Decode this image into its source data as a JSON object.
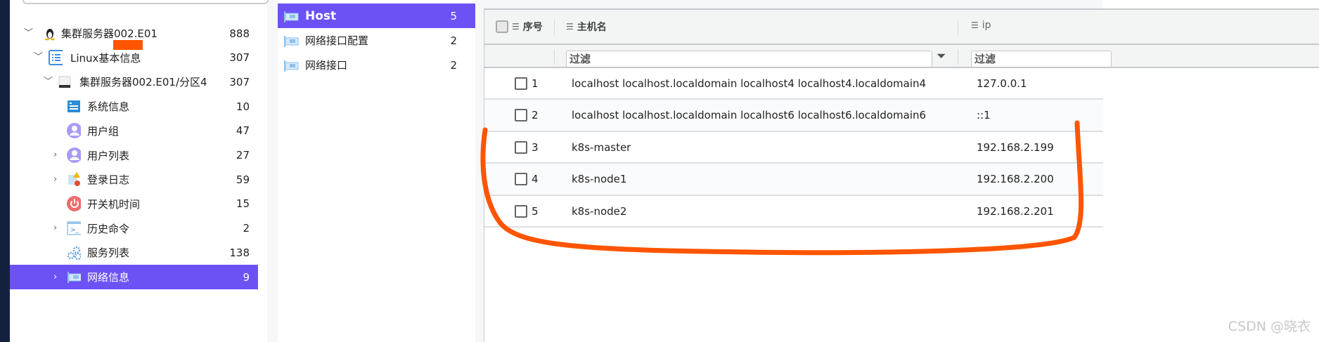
{
  "tree": {
    "items": [
      {
        "label": "集群服务器002.E01",
        "count": "888",
        "icon": "linux-penguin-icon",
        "chevron": "down"
      },
      {
        "label": "Linux基本信息",
        "count": "307",
        "icon": "list-icon",
        "chevron": "down"
      },
      {
        "label": "集群服务器002.E01/分区4",
        "count": "307",
        "icon": "disk-icon",
        "chevron": "down"
      },
      {
        "label": "系统信息",
        "count": "10",
        "icon": "system-info-icon",
        "chevron": ""
      },
      {
        "label": "用户组",
        "count": "47",
        "icon": "user-icon",
        "chevron": ""
      },
      {
        "label": "用户列表",
        "count": "27",
        "icon": "user-icon",
        "chevron": "right"
      },
      {
        "label": "登录日志",
        "count": "59",
        "icon": "log-warning-icon",
        "chevron": "right"
      },
      {
        "label": "开关机时间",
        "count": "15",
        "icon": "power-icon",
        "chevron": ""
      },
      {
        "label": "历史命令",
        "count": "2",
        "icon": "terminal-icon",
        "chevron": "right"
      },
      {
        "label": "服务列表",
        "count": "138",
        "icon": "gears-icon",
        "chevron": ""
      },
      {
        "label": "网络信息",
        "count": "9",
        "icon": "network-card-icon",
        "chevron": "right",
        "selected": true
      }
    ]
  },
  "subnav": {
    "items": [
      {
        "label": "Host",
        "count": "5",
        "selected": true
      },
      {
        "label": "网络接口配置",
        "count": "2"
      },
      {
        "label": "网络接口",
        "count": "2"
      }
    ]
  },
  "table": {
    "columns": {
      "index": "序号",
      "hostname": "主机名",
      "ip": "ip"
    },
    "filter_placeholder": "过滤",
    "rows": [
      {
        "index": "1",
        "hostname": "localhost localhost.localdomain localhost4 localhost4.localdomain4",
        "ip": "127.0.0.1"
      },
      {
        "index": "2",
        "hostname": "localhost localhost.localdomain localhost6 localhost6.localdomain6",
        "ip": "::1"
      },
      {
        "index": "3",
        "hostname": "k8s-master",
        "ip": "192.168.2.199"
      },
      {
        "index": "4",
        "hostname": "k8s-node1",
        "ip": "192.168.2.200"
      },
      {
        "index": "5",
        "hostname": "k8s-node2",
        "ip": "192.168.2.201"
      }
    ]
  },
  "watermark": "CSDN @晓衣",
  "colors": {
    "accent": "#6c52f5",
    "annotation": "#ff5500",
    "sidebar_dark": "#13213f"
  }
}
